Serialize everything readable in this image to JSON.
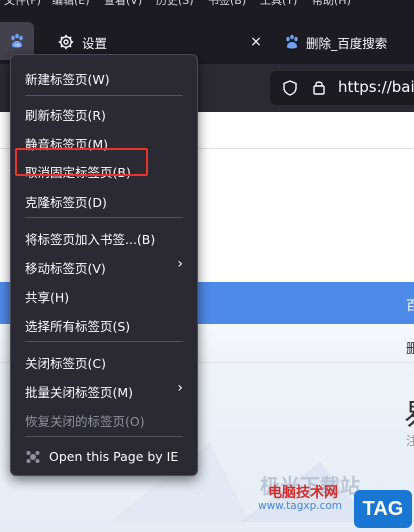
{
  "menubar": [
    "文件(F)",
    "编辑(E)",
    "查看(V)",
    "历史(S)",
    "书签(B)",
    "工具(T)",
    "帮助(H)"
  ],
  "tabs": {
    "settings_label": "设置",
    "active_label": "删除_百度搜索",
    "close_glyph": "×"
  },
  "urlbar": {
    "url": "https://baik"
  },
  "context_menu": {
    "items": [
      {
        "label": "新建标签页(W)"
      },
      {
        "label": "刷新标签页(R)"
      },
      {
        "label": "静音标签页(M)"
      },
      {
        "label": "取消固定标签页(B)",
        "highlighted": true
      },
      {
        "label": "克隆标签页(D)"
      },
      {
        "label": "将标签页加入书签...(B)"
      },
      {
        "label": "移动标签页(V)",
        "submenu": true
      },
      {
        "label": "共享(H)"
      },
      {
        "label": "选择所有标签页(S)"
      },
      {
        "label": "关闭标签页(C)"
      },
      {
        "label": "批量关闭标签页(M)",
        "submenu": true
      },
      {
        "label": "恢复关闭的标签页(O)",
        "disabled": true
      },
      {
        "label": "Open this Page by IE"
      }
    ],
    "submenu_glyph": "›"
  },
  "page": {
    "bluebar_text": "百",
    "row_text": "删",
    "big_char": "易",
    "small_text": "注"
  },
  "watermark": {
    "top": "极光下载站",
    "title": "电脑技术网",
    "site": "www.tagxp.com",
    "badge": "TAG"
  },
  "colors": {
    "highlight_border": "#e5352c",
    "menu_bg": "#2b2a33",
    "tab_bg": "#1c1b22",
    "accent_blue": "#4e8ae8"
  }
}
